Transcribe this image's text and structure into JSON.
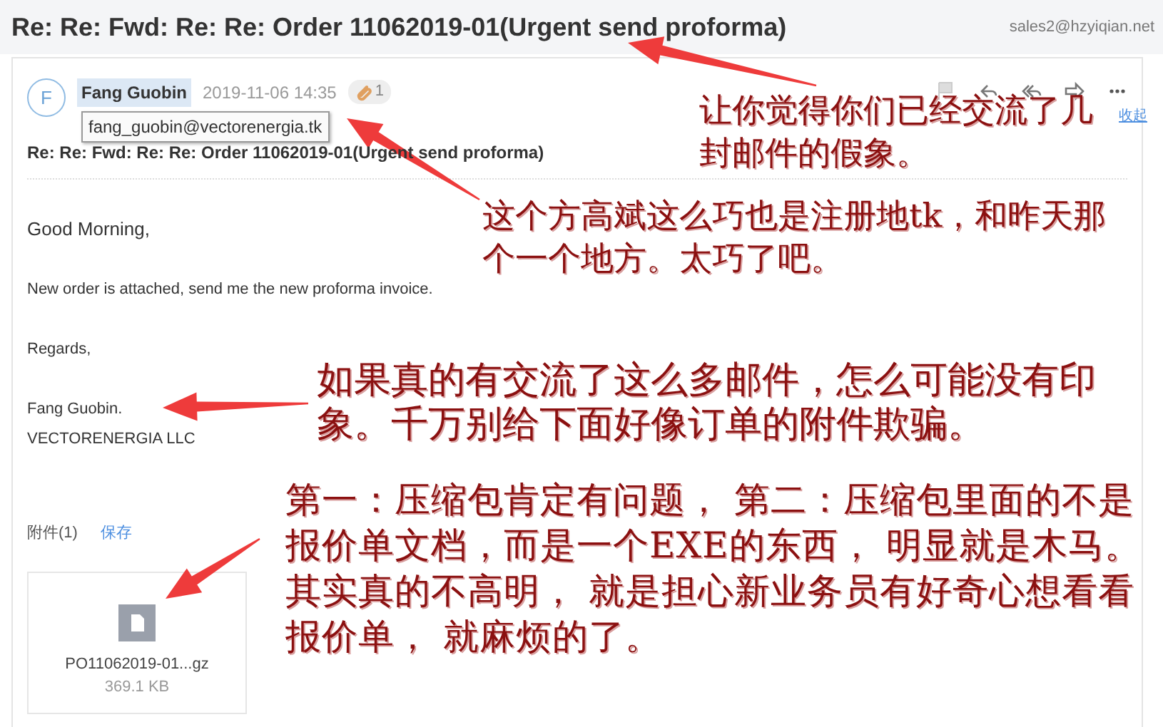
{
  "header": {
    "subject": "Re: Re: Fwd: Re: Re: Order 11062019-01(Urgent send proforma)",
    "account": "sales2@hzyiqian.net"
  },
  "message": {
    "avatar_letter": "F",
    "sender": "Fang Guobin",
    "date": "2019-11-06 14:35",
    "attachment_count": "1",
    "tooltip": "fang_guobin@vectorenergia.tk",
    "collapse_link": "收起",
    "subject": "Re: Re: Fwd: Re: Re: Order 11062019-01(Urgent send proforma)",
    "body": [
      {
        "kind": "greeting",
        "lines": [
          "Good Morning,"
        ]
      },
      {
        "kind": "text",
        "lines": [
          "New order is attached, send me the  new proforma invoice."
        ]
      },
      {
        "kind": "text",
        "lines": [
          "Regards,"
        ]
      },
      {
        "kind": "text",
        "lines": [
          "Fang Guobin.",
          "VECTORENERGIA LLC"
        ]
      }
    ]
  },
  "attachments": {
    "label": "附件(1)",
    "save_link": "保存",
    "files": [
      {
        "name": "PO11062019-01...gz",
        "size": "369.1 KB"
      }
    ]
  },
  "annotations": [
    {
      "text": "让你觉得你们已经交流了几封邮件的假象。"
    },
    {
      "text": "这个方高斌这么巧也是注册地tk，和昨天那个一个地方。太巧了吧。"
    },
    {
      "text": "如果真的有交流了这么多邮件，怎么可能没有印象。千万别给下面好像订单的附件欺骗。"
    },
    {
      "text": "第一：压缩包肯定有问题， 第二：压缩包里面的不是报价单文档，而是一个EXE的东西， 明显就是木马。其实真的不高明， 就是担心新业务员有好奇心想看看报价单， 就麻烦的了。"
    }
  ]
}
